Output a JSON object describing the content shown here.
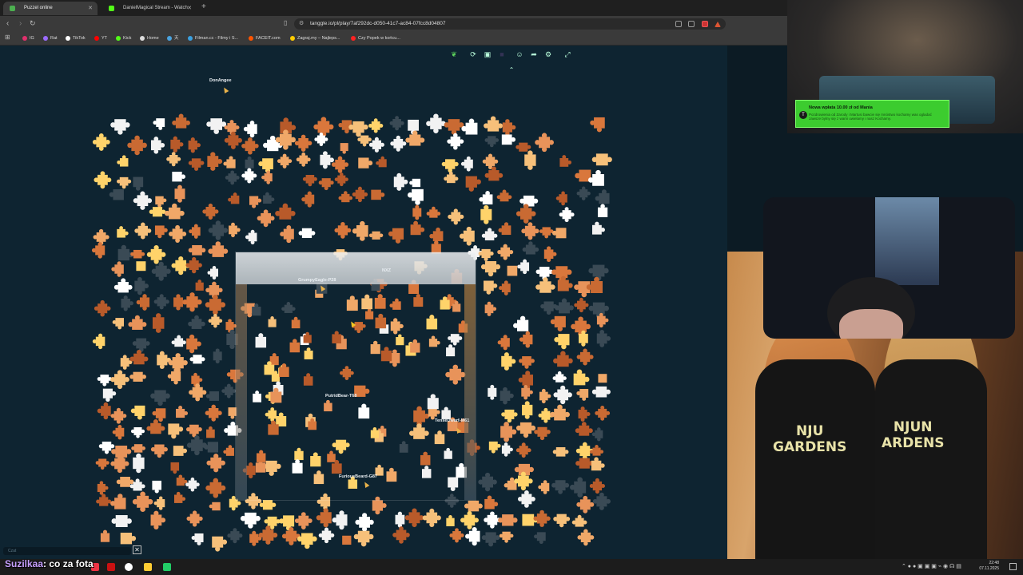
{
  "browser": {
    "tabs": [
      {
        "label": "Puzzel online",
        "active": true,
        "favicon_color": "#4caf50"
      },
      {
        "label": "DanielMagical Stream - Watch Li...",
        "active": false,
        "favicon_color": "#53fc18"
      }
    ],
    "url": "tanggle.io/pl/play/7af292dc-d050-41c7-ac84-07fcc8d04807",
    "bookmarks": [
      {
        "label": "IG",
        "color": "#e1306c"
      },
      {
        "label": "Rat",
        "color": "#9b6bff"
      },
      {
        "label": "TikTok",
        "color": "#ffffff"
      },
      {
        "label": "YT",
        "color": "#ff0000"
      },
      {
        "label": "Kick",
        "color": "#53fc18"
      },
      {
        "label": "Home",
        "color": "#dddddd"
      },
      {
        "label": "天",
        "color": "#4aa3df"
      },
      {
        "label": "Filman.cc - Filmy i S...",
        "color": "#3aa0e0"
      },
      {
        "label": "FACEIT.com",
        "color": "#ff5500"
      },
      {
        "label": "Zagraj.my – Najleps...",
        "color": "#ffcc00"
      },
      {
        "label": "Czy Popek w końcu...",
        "color": "#ff2222"
      }
    ]
  },
  "game": {
    "players": [
      {
        "name": "DonAngee"
      },
      {
        "name": "GrumpyEagle-P28"
      },
      {
        "name": "NXZ"
      },
      {
        "name": "PutridBear-T68"
      },
      {
        "name": "TenseDwarf-M61"
      },
      {
        "name": "FuriousBeard-G87"
      }
    ],
    "chat_placeholder": "Czat",
    "toolbar_icons": [
      "leaf-icon",
      "rotate-icon",
      "image-icon",
      "square-icon",
      "users-icon",
      "share-icon",
      "settings-icon",
      "fullscreen-icon"
    ]
  },
  "stream": {
    "donation": {
      "title": "Nowa wpłata 10.00 zł od Mania",
      "message": "Pozdrowienia od Zarody i Martusi bawcie się mnóstwo kochamy was ogladać zawsze bylny się z wami uwielamy i nasz Kochamy."
    },
    "shirt_left": "NJU\nGARDENS",
    "shirt_right": "NJUN\nARDENS",
    "overlay_user": "Suzilkaa",
    "overlay_message": "co za fota"
  },
  "taskbar": {
    "time": "22:48",
    "date": "07.11.2025"
  }
}
